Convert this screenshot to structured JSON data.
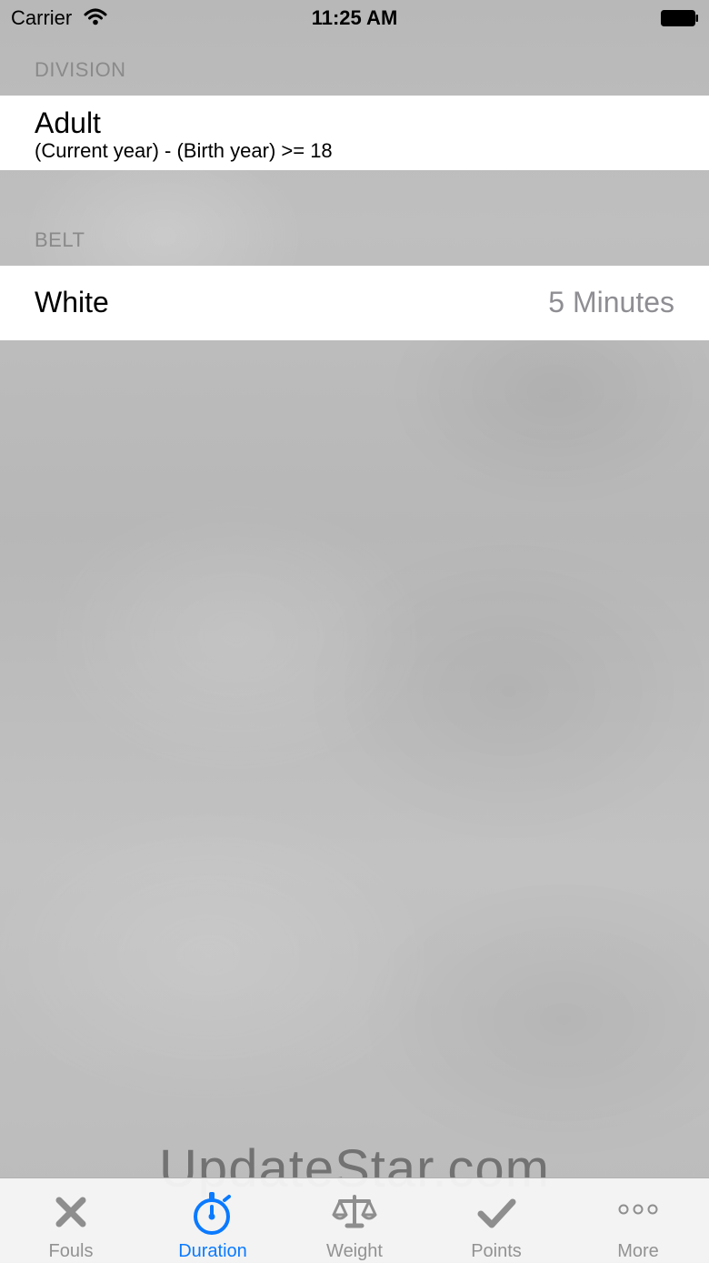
{
  "status_bar": {
    "carrier": "Carrier",
    "time": "11:25 AM"
  },
  "sections": [
    {
      "header": "DIVISION",
      "rows": [
        {
          "title": "Adult",
          "subtitle": "(Current year) - (Birth year) >= 18"
        }
      ]
    },
    {
      "header": "BELT",
      "rows": [
        {
          "title": "White",
          "detail": "5 Minutes"
        }
      ]
    }
  ],
  "tab_bar": {
    "items": [
      {
        "label": "Fouls",
        "icon": "close-icon",
        "selected": false
      },
      {
        "label": "Duration",
        "icon": "stopwatch-icon",
        "selected": true
      },
      {
        "label": "Weight",
        "icon": "scale-icon",
        "selected": false
      },
      {
        "label": "Points",
        "icon": "checkmark-icon",
        "selected": false
      },
      {
        "label": "More",
        "icon": "more-icon",
        "selected": false
      }
    ]
  },
  "watermark": "UpdateStar.com",
  "colors": {
    "accent": "#0a7aff",
    "inactive": "#929292",
    "section_header": "#8a8a8a",
    "background": "#bdbdbd"
  }
}
